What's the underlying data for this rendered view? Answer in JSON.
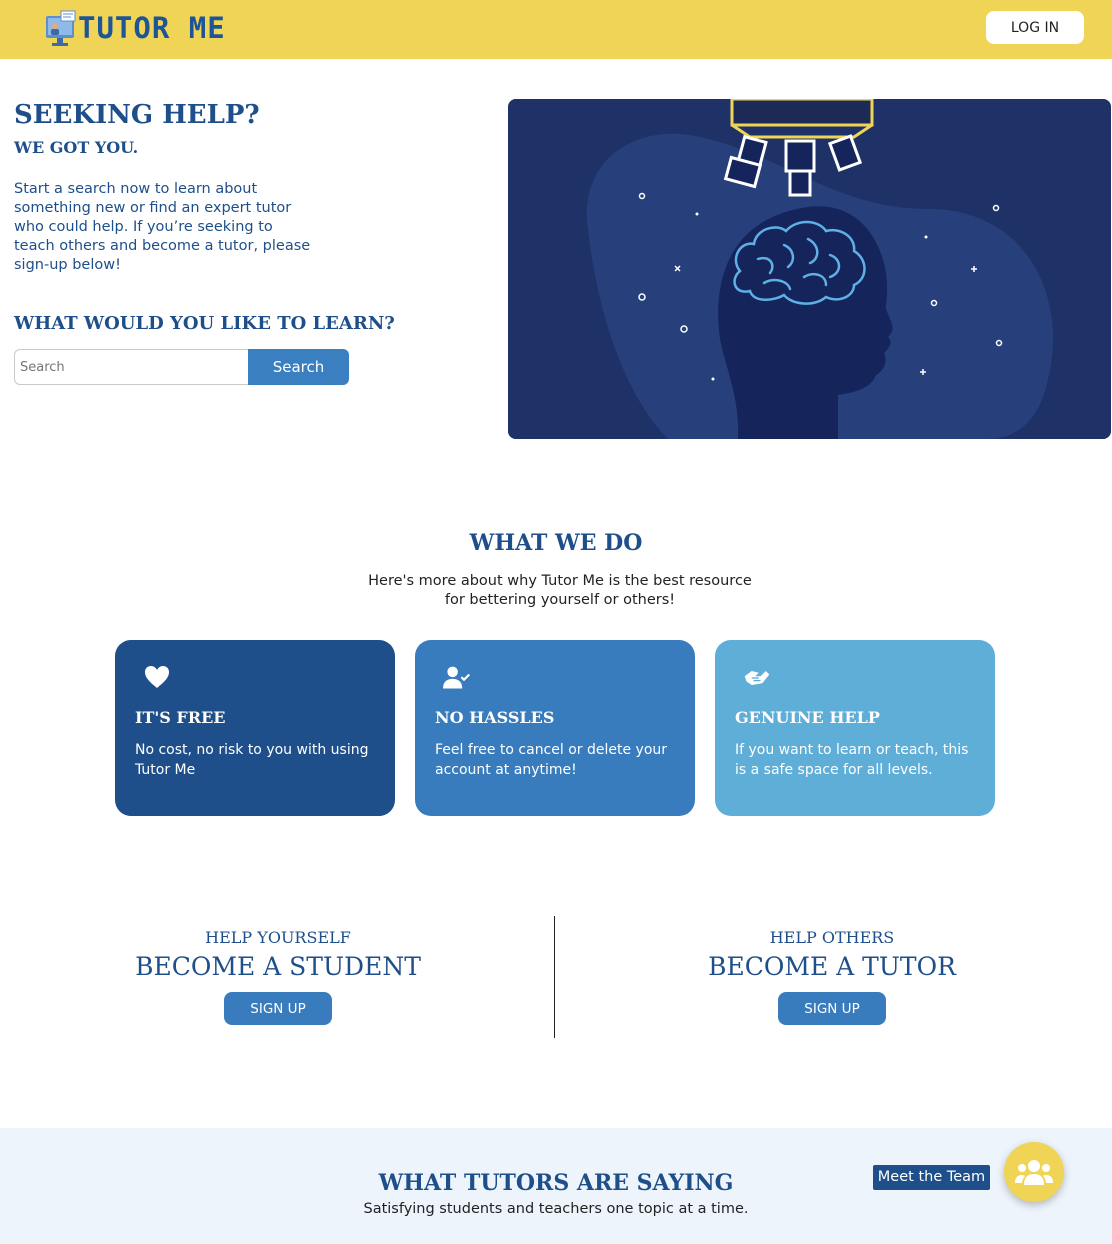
{
  "header": {
    "logo_text": "TUTOR ME",
    "login_label": "LOG IN"
  },
  "hero": {
    "title": "SEEKING HELP?",
    "subtitle": "WE GOT YOU.",
    "text": "Start a search now to learn about something new or find an expert tutor who could help. If you’re seeking to teach others and become a tutor, please sign-up below!",
    "learn_title": "WHAT WOULD YOU LIKE TO LEARN?",
    "search_placeholder": "Search",
    "search_button": "Search"
  },
  "what_we_do": {
    "title": "WHAT WE DO",
    "text": "Here's more about why Tutor Me is the best resource for bettering yourself or others!",
    "cards": [
      {
        "icon": "heart-icon",
        "title": "IT'S FREE",
        "text": "No cost, no risk to you with using Tutor Me",
        "color": "#1e4f8a"
      },
      {
        "icon": "user-check-icon",
        "title": "NO HASSLES",
        "text": "Feel free to cancel or delete your account at anytime!",
        "color": "#387cbd"
      },
      {
        "icon": "handshake-icon",
        "title": "GENUINE HELP",
        "text": "If you want to learn or teach, this is a safe space for all levels.",
        "color": "#5faed8"
      }
    ]
  },
  "signup": {
    "student": {
      "kicker": "HELP YOURSELF",
      "title": "BECOME A STUDENT",
      "button": "SIGN UP"
    },
    "tutor": {
      "kicker": "HELP OTHERS",
      "title": "BECOME A TUTOR",
      "button": "SIGN UP"
    }
  },
  "testimonials": {
    "title": "WHAT TUTORS ARE SAYING",
    "subtitle": "Satisfying students and teachers one topic at a time."
  },
  "team": {
    "label": "Meet the Team",
    "icon": "users-icon"
  },
  "colors": {
    "header_bg": "#f0d456",
    "primary_dark": "#1e4f8a",
    "primary": "#387cbd",
    "primary_light": "#5faed8"
  }
}
